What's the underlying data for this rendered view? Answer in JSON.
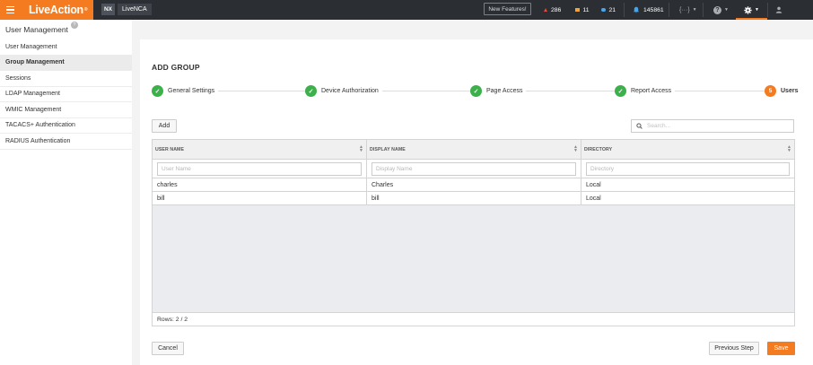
{
  "topbar": {
    "brand": "LiveAction",
    "brand_mark": "®",
    "nx_label": "NX",
    "product": "LiveNCA",
    "new_features": "New Features!",
    "alerts": {
      "critical": "286",
      "warning": "11",
      "info": "21"
    },
    "notifications": "145861",
    "code_label": "{···}",
    "help_label": "?",
    "colors": {
      "brand_orange": "#f47b20",
      "bar_bg": "#2b2e33",
      "critical": "#e64a3b",
      "warning": "#f2a62c",
      "info": "#4aa5e8"
    }
  },
  "sidebar": {
    "title": "User Management",
    "help": "?",
    "items": [
      {
        "label": "User Management",
        "active": false
      },
      {
        "label": "Group Management",
        "active": true
      },
      {
        "label": "Sessions",
        "active": false
      },
      {
        "label": "LDAP Management",
        "active": false
      },
      {
        "label": "WMIC Management",
        "active": false
      },
      {
        "label": "TACACS+ Authentication",
        "active": false
      },
      {
        "label": "RADIUS Authentication",
        "active": false
      }
    ]
  },
  "main": {
    "title": "ADD GROUP",
    "steps": [
      {
        "label": "General Settings",
        "done": true
      },
      {
        "label": "Device Authorization",
        "done": true
      },
      {
        "label": "Page Access",
        "done": true
      },
      {
        "label": "Report Access",
        "done": true
      },
      {
        "label": "Users",
        "number": "5",
        "current": true
      }
    ],
    "add_button": "Add",
    "search_placeholder": "Search...",
    "table": {
      "columns": [
        "USER NAME",
        "DISPLAY NAME",
        "DIRECTORY"
      ],
      "filters": [
        "User Name",
        "Display Name",
        "Directory"
      ],
      "rows": [
        [
          "charles",
          "Charles",
          "Local"
        ],
        [
          "bill",
          "bill",
          "Local"
        ]
      ],
      "footer": "Rows: 2 / 2"
    },
    "cancel_button": "Cancel",
    "previous_button": "Previous Step",
    "save_button": "Save"
  }
}
